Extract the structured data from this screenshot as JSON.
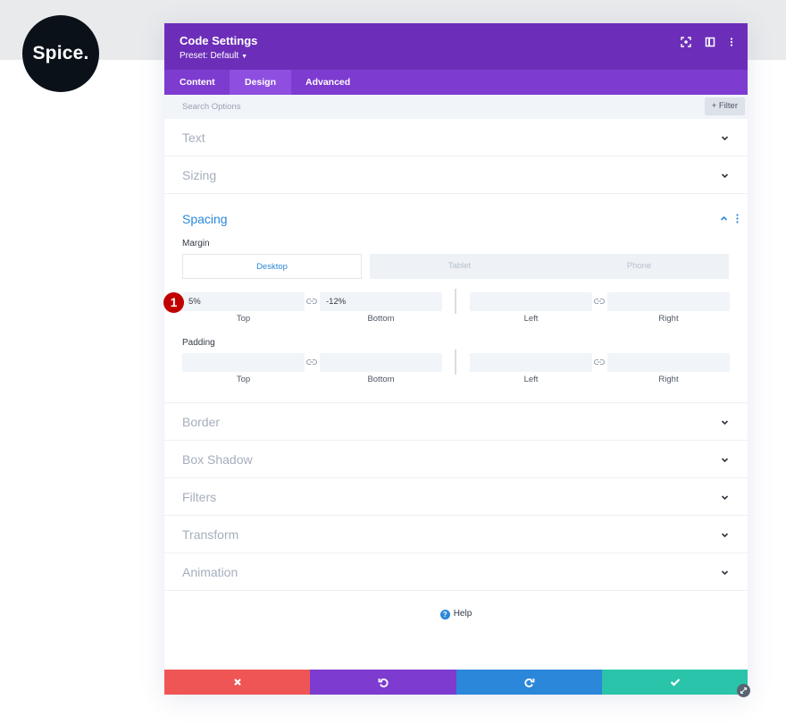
{
  "brand": {
    "logo_text": "Spice."
  },
  "modal": {
    "title": "Code Settings",
    "preset_label": "Preset: Default",
    "header_icons": [
      "focus-icon",
      "split-view-icon",
      "more-vertical-icon"
    ],
    "colors": {
      "header": "#6c2eb9",
      "tabs": "#7d3bcf",
      "accent": "#2c88d9",
      "cancel": "#ef5555",
      "undo": "#7d3bcf",
      "redo": "#2b87da",
      "save": "#29c4a9",
      "badge": "#c00000"
    }
  },
  "tabs": [
    {
      "label": "Content",
      "active": false
    },
    {
      "label": "Design",
      "active": true
    },
    {
      "label": "Advanced",
      "active": false
    }
  ],
  "search": {
    "placeholder": "Search Options",
    "filter_label": "+ Filter"
  },
  "groups_before": [
    {
      "label": "Text",
      "expanded": false
    },
    {
      "label": "Sizing",
      "expanded": false
    }
  ],
  "spacing": {
    "label": "Spacing",
    "expanded": true,
    "margin_label": "Margin",
    "devices": [
      {
        "label": "Desktop",
        "active": true
      },
      {
        "label": "Tablet",
        "active": false
      },
      {
        "label": "Phone",
        "active": false
      }
    ],
    "margin": {
      "top": "5%",
      "bottom": "-12%",
      "left": "",
      "right": ""
    },
    "padding_label": "Padding",
    "padding": {
      "top": "",
      "bottom": "",
      "left": "",
      "right": ""
    },
    "field_labels": {
      "top": "Top",
      "bottom": "Bottom",
      "left": "Left",
      "right": "Right"
    },
    "step_badge": "1"
  },
  "groups_after": [
    {
      "label": "Border",
      "expanded": false
    },
    {
      "label": "Box Shadow",
      "expanded": false
    },
    {
      "label": "Filters",
      "expanded": false
    },
    {
      "label": "Transform",
      "expanded": false
    },
    {
      "label": "Animation",
      "expanded": false
    }
  ],
  "help": {
    "label": "Help",
    "icon": "question-circle-icon"
  },
  "footer": {
    "icons": [
      "close-icon",
      "undo-icon",
      "redo-icon",
      "check-icon"
    ]
  }
}
